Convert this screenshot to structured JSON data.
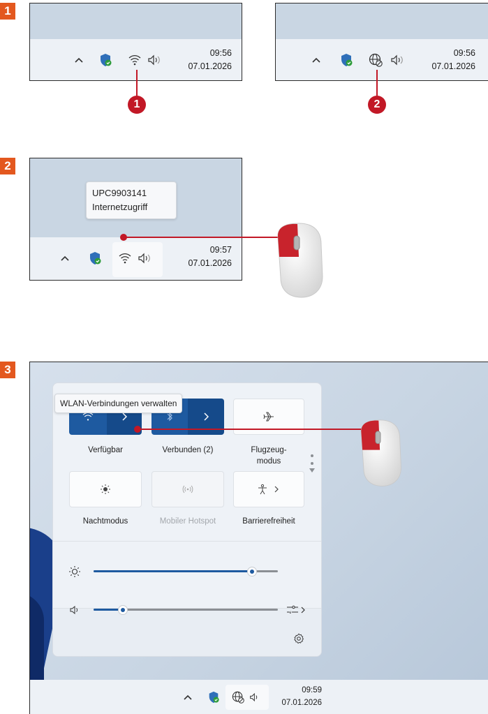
{
  "steps": [
    {
      "badge": "1"
    },
    {
      "badge": "2"
    },
    {
      "badge": "3"
    }
  ],
  "colors": {
    "accent": "#e3581f",
    "callout": "#c21826",
    "toggle_on": "#1e5aa0"
  },
  "step1": {
    "left_shot": {
      "time": "09:56",
      "date": "07.01.2026",
      "callout": "1",
      "network_icon": "wifi-icon"
    },
    "right_shot": {
      "time": "09:56",
      "date": "07.01.2026",
      "callout": "2",
      "network_icon": "globe-no-internet-icon"
    }
  },
  "step2": {
    "tooltip_line1": "UPC9903141",
    "tooltip_line2": "Internetzugriff",
    "time": "09:57",
    "date": "07.01.2026"
  },
  "step3": {
    "tooltip": "WLAN-Verbindungen verwalten",
    "tiles": [
      {
        "label": "Verfügbar",
        "icon": "wifi-icon",
        "state": "on"
      },
      {
        "label": "Verbunden (2)",
        "icon": "bluetooth-icon",
        "state": "on"
      },
      {
        "label": "Flugzeug-modus",
        "label_line1": "Flugzeug-",
        "label_line2": "modus",
        "icon": "airplane-icon",
        "state": "off"
      },
      {
        "label": "Nachtmodus",
        "icon": "night-light-icon",
        "state": "off"
      },
      {
        "label": "Mobiler Hotspot",
        "icon": "hotspot-icon",
        "state": "disabled"
      },
      {
        "label": "Barrierefreiheit",
        "icon": "accessibility-icon",
        "state": "off"
      }
    ],
    "brightness_level": 0.88,
    "volume_level": 0.14,
    "time": "09:59",
    "date": "07.01.2026"
  }
}
